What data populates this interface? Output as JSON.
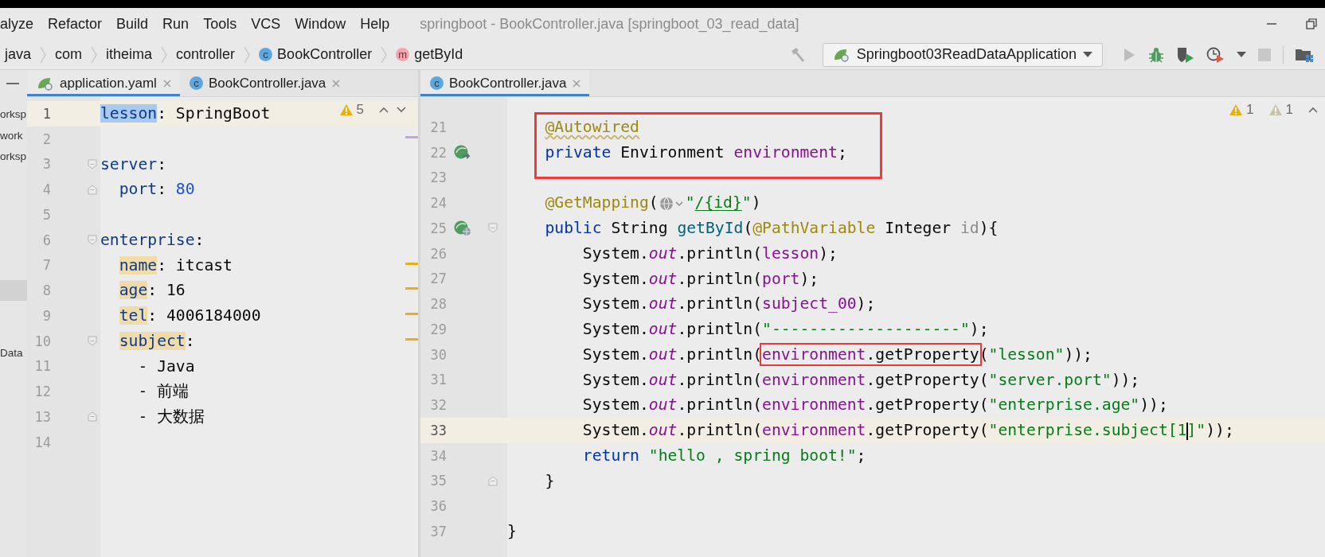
{
  "menu_bar": {
    "items": [
      {
        "label": "alyze"
      },
      {
        "label": "Refactor"
      },
      {
        "label": "Build"
      },
      {
        "label": "Run"
      },
      {
        "label": "Tools"
      },
      {
        "label": "VCS"
      },
      {
        "label": "Window"
      },
      {
        "label": "Help"
      }
    ],
    "window_title": "springboot - BookController.java [springboot_03_read_data]"
  },
  "navigation_bar": {
    "breadcrumbs": [
      {
        "label": "java",
        "kind": "package"
      },
      {
        "label": "com",
        "kind": "package"
      },
      {
        "label": "itheima",
        "kind": "package"
      },
      {
        "label": "controller",
        "kind": "package"
      },
      {
        "label": "BookController",
        "kind": "class",
        "badge": "c"
      },
      {
        "label": "getById",
        "kind": "method",
        "badge": "m"
      }
    ],
    "run_configuration": "Springboot03ReadDataApplication"
  },
  "project_panel": {
    "items": [
      {
        "label": "orksp",
        "selected": false
      },
      {
        "label": "work",
        "selected": false
      },
      {
        "label": "orksp",
        "selected": false
      },
      {
        "selected": true
      },
      {
        "label": "Data",
        "selected": false
      }
    ]
  },
  "editors": [
    {
      "tabs": [
        {
          "label": "application.yaml",
          "kind": "spring",
          "selected": true
        },
        {
          "label": "BookController.java",
          "kind": "class",
          "badge": "c",
          "selected": false
        }
      ],
      "inspections": [
        {
          "kind": "warning",
          "count": "5"
        }
      ],
      "lines": [
        {
          "number": "1",
          "current": true,
          "tokens": [
            {
              "text": "lesson",
              "kind": "yaml-key",
              "selected": true
            },
            {
              "text": ": SpringBoot",
              "kind": "plain"
            }
          ]
        },
        {
          "number": "2",
          "current": false,
          "change_mark": true
        },
        {
          "number": "3",
          "current": false,
          "fold_start": true,
          "tokens": [
            {
              "text": "server",
              "kind": "yaml-key"
            },
            {
              "text": ":",
              "kind": "plain"
            }
          ]
        },
        {
          "number": "4",
          "current": false,
          "fold_end": true,
          "tokens": [
            {
              "text": "  port",
              "kind": "yaml-key"
            },
            {
              "text": ": ",
              "kind": "plain"
            },
            {
              "text": "80",
              "kind": "number"
            }
          ]
        },
        {
          "number": "5",
          "current": false
        },
        {
          "number": "6",
          "current": false,
          "fold_start": true,
          "tokens": [
            {
              "text": "enterprise",
              "kind": "yaml-key"
            },
            {
              "text": ":",
              "kind": "plain"
            }
          ]
        },
        {
          "number": "7",
          "current": false,
          "warning_mark": true,
          "tokens": [
            {
              "text": "  name",
              "kind": "yaml-key",
              "highlighted": true
            },
            {
              "text": ": itcast",
              "kind": "plain"
            }
          ]
        },
        {
          "number": "8",
          "current": false,
          "warning_mark": true,
          "tokens": [
            {
              "text": "  age",
              "kind": "yaml-key",
              "highlighted": true
            },
            {
              "text": ": 16",
              "kind": "plain"
            }
          ]
        },
        {
          "number": "9",
          "current": false,
          "warning_mark": true,
          "tokens": [
            {
              "text": "  tel",
              "kind": "yaml-key",
              "highlighted": true
            },
            {
              "text": ": 4006184000",
              "kind": "plain"
            }
          ]
        },
        {
          "number": "10",
          "current": false,
          "warning_mark": true,
          "fold_start": true,
          "tokens": [
            {
              "text": "  subject",
              "kind": "yaml-key",
              "highlighted": true
            },
            {
              "text": ":",
              "kind": "plain"
            }
          ]
        },
        {
          "number": "11",
          "current": false,
          "tokens": [
            {
              "text": "    - Java",
              "kind": "plain"
            }
          ]
        },
        {
          "number": "12",
          "current": false,
          "tokens": [
            {
              "text": "    - 前端",
              "kind": "plain"
            }
          ]
        },
        {
          "number": "13",
          "current": false,
          "fold_end": true,
          "tokens": [
            {
              "text": "    - 大数据",
              "kind": "plain"
            }
          ]
        },
        {
          "number": "14",
          "current": false
        }
      ]
    },
    {
      "tabs": [
        {
          "label": "BookController.java",
          "kind": "class",
          "badge": "c",
          "selected": true
        }
      ],
      "inspections": [
        {
          "kind": "warning",
          "count": "1"
        },
        {
          "kind": "weak-warning",
          "count": "1"
        }
      ],
      "lines": [
        {
          "number": "21",
          "current": false,
          "framed": true,
          "tokens": [
            {
              "text": "    @Autowired",
              "kind": "annotation",
              "warning": true
            }
          ]
        },
        {
          "number": "22",
          "current": false,
          "framed": true,
          "bean_icon": true,
          "tokens": [
            {
              "text": "    private",
              "kind": "keyword"
            },
            {
              "text": " Environment ",
              "kind": "plain"
            },
            {
              "text": "environment",
              "kind": "field"
            },
            {
              "text": ";",
              "kind": "plain"
            }
          ]
        },
        {
          "number": "23",
          "current": false,
          "framed": true
        },
        {
          "number": "24",
          "current": false,
          "tokens": [
            {
              "text": "    @GetMapping",
              "kind": "annotation"
            },
            {
              "text": "(",
              "kind": "plain"
            },
            {
              "kind": "inlay"
            },
            {
              "text": "\"",
              "kind": "string"
            },
            {
              "text": "/{id}",
              "kind": "url"
            },
            {
              "text": "\"",
              "kind": "string"
            },
            {
              "text": ")",
              "kind": "plain"
            }
          ]
        },
        {
          "number": "25",
          "current": false,
          "web_bean_icon": true,
          "fold_start": true,
          "tokens": [
            {
              "text": "    public",
              "kind": "keyword"
            },
            {
              "text": " String ",
              "kind": "plain"
            },
            {
              "text": "getById",
              "kind": "method"
            },
            {
              "text": "(",
              "kind": "plain"
            },
            {
              "text": "@PathVariable",
              "kind": "annotation"
            },
            {
              "text": " Integer ",
              "kind": "plain"
            },
            {
              "text": "id",
              "kind": "unused"
            },
            {
              "text": "){",
              "kind": "plain"
            }
          ]
        },
        {
          "number": "26",
          "current": false,
          "tokens": [
            {
              "text": "        System.",
              "kind": "plain"
            },
            {
              "text": "out",
              "kind": "static"
            },
            {
              "text": ".println(",
              "kind": "plain"
            },
            {
              "text": "lesson",
              "kind": "field"
            },
            {
              "text": ");",
              "kind": "plain"
            }
          ]
        },
        {
          "number": "27",
          "current": false,
          "tokens": [
            {
              "text": "        System.",
              "kind": "plain"
            },
            {
              "text": "out",
              "kind": "static"
            },
            {
              "text": ".println(",
              "kind": "plain"
            },
            {
              "text": "port",
              "kind": "field"
            },
            {
              "text": ");",
              "kind": "plain"
            }
          ]
        },
        {
          "number": "28",
          "current": false,
          "tokens": [
            {
              "text": "        System.",
              "kind": "plain"
            },
            {
              "text": "out",
              "kind": "static"
            },
            {
              "text": ".println(",
              "kind": "plain"
            },
            {
              "text": "subject_00",
              "kind": "field"
            },
            {
              "text": ");",
              "kind": "plain"
            }
          ]
        },
        {
          "number": "29",
          "current": false,
          "tokens": [
            {
              "text": "        System.",
              "kind": "plain"
            },
            {
              "text": "out",
              "kind": "static"
            },
            {
              "text": ".println(",
              "kind": "plain"
            },
            {
              "text": "\"--------------------\"",
              "kind": "string"
            },
            {
              "text": ");",
              "kind": "plain"
            }
          ]
        },
        {
          "number": "30",
          "current": false,
          "tokens": [
            {
              "text": "        System.",
              "kind": "plain"
            },
            {
              "text": "out",
              "kind": "static"
            },
            {
              "text": ".println(",
              "kind": "plain"
            },
            {
              "text": "environment",
              "kind": "field",
              "boxed": true
            },
            {
              "text": ".getProperty",
              "kind": "plain",
              "boxed": true
            },
            {
              "text": "(",
              "kind": "plain"
            },
            {
              "text": "\"lesson\"",
              "kind": "string"
            },
            {
              "text": "));",
              "kind": "plain"
            }
          ]
        },
        {
          "number": "31",
          "current": false,
          "tokens": [
            {
              "text": "        System.",
              "kind": "plain"
            },
            {
              "text": "out",
              "kind": "static"
            },
            {
              "text": ".println(",
              "kind": "plain"
            },
            {
              "text": "environment",
              "kind": "field"
            },
            {
              "text": ".getProperty(",
              "kind": "plain"
            },
            {
              "text": "\"server.port\"",
              "kind": "string"
            },
            {
              "text": "));",
              "kind": "plain"
            }
          ]
        },
        {
          "number": "32",
          "current": false,
          "tokens": [
            {
              "text": "        System.",
              "kind": "plain"
            },
            {
              "text": "out",
              "kind": "static"
            },
            {
              "text": ".println(",
              "kind": "plain"
            },
            {
              "text": "environment",
              "kind": "field"
            },
            {
              "text": ".getProperty(",
              "kind": "plain"
            },
            {
              "text": "\"enterprise.age\"",
              "kind": "string"
            },
            {
              "text": "));",
              "kind": "plain"
            }
          ]
        },
        {
          "number": "33",
          "current": true,
          "tokens": [
            {
              "text": "        System.",
              "kind": "plain"
            },
            {
              "text": "out",
              "kind": "static"
            },
            {
              "text": ".println(",
              "kind": "plain"
            },
            {
              "text": "environment",
              "kind": "field"
            },
            {
              "text": ".getProperty(",
              "kind": "plain"
            },
            {
              "text": "\"enterprise.subject[1",
              "kind": "string"
            },
            {
              "kind": "caret"
            },
            {
              "text": "]\"",
              "kind": "string"
            },
            {
              "text": "));",
              "kind": "plain"
            }
          ]
        },
        {
          "number": "34",
          "current": false,
          "tokens": [
            {
              "text": "        return",
              "kind": "keyword"
            },
            {
              "text": " \"hello , spring boot!\"",
              "kind": "string"
            },
            {
              "text": ";",
              "kind": "plain"
            }
          ]
        },
        {
          "number": "35",
          "current": false,
          "fold_end": true,
          "tokens": [
            {
              "text": "    }",
              "kind": "plain"
            }
          ]
        },
        {
          "number": "36",
          "current": false
        },
        {
          "number": "37",
          "current": false,
          "tokens": [
            {
              "text": "}",
              "kind": "plain"
            }
          ]
        }
      ]
    }
  ]
}
